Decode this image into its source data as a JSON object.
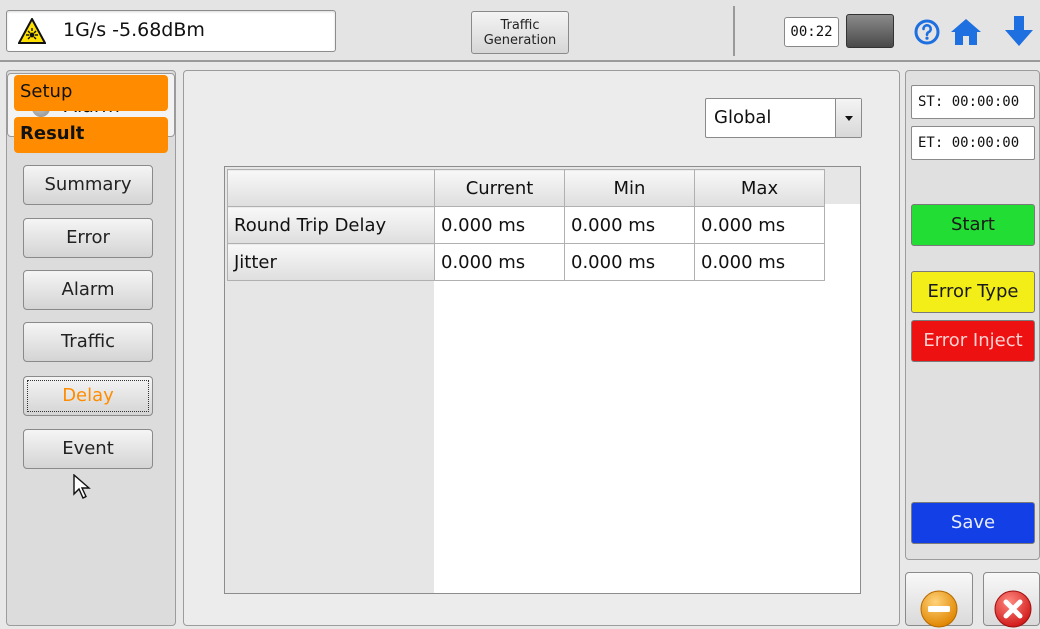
{
  "header": {
    "signal_status": "1G/s -5.68dBm",
    "traffic_button_line1": "Traffic",
    "traffic_button_line2": "Generation",
    "timer": "00:22",
    "icons": [
      "laser-warning-icon",
      "battery-icon",
      "help-icon",
      "home-icon",
      "down-arrow-icon"
    ]
  },
  "left": {
    "alarm_label": "Alarm",
    "tabs": {
      "setup": "Setup",
      "result": "Result"
    },
    "buttons": {
      "summary": "Summary",
      "error": "Error",
      "alarm": "Alarm",
      "traffic": "Traffic",
      "delay": "Delay",
      "event": "Event"
    },
    "selected_button": "Delay"
  },
  "main": {
    "scope_select": "Global",
    "table": {
      "columns": [
        "Current",
        "Min",
        "Max"
      ],
      "rows": [
        {
          "label": "Round Trip Delay",
          "values": [
            "0.000 ms",
            "0.000 ms",
            "0.000 ms"
          ]
        },
        {
          "label": "Jitter",
          "values": [
            "0.000 ms",
            "0.000 ms",
            "0.000 ms"
          ]
        }
      ]
    }
  },
  "right": {
    "start_time": "ST: 00:00:00",
    "elapsed_time": "ET: 00:00:00",
    "start_label": "Start",
    "error_type_label": "Error Type",
    "error_inject_label": "Error Inject",
    "save_label": "Save"
  },
  "colors": {
    "accent_orange": "#ff8c00",
    "start_green": "#22dd33",
    "error_type_yellow": "#f3ee17",
    "error_inject_red": "#ee1111",
    "save_blue": "#1240e6"
  }
}
